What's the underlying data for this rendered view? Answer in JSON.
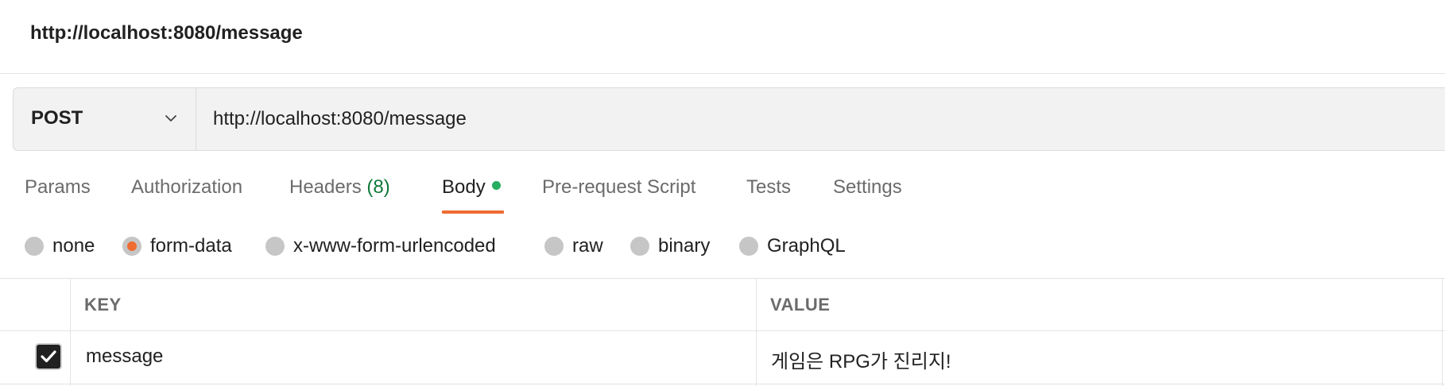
{
  "header": {
    "title": "http://localhost:8080/message"
  },
  "request": {
    "method": "POST",
    "url": "http://localhost:8080/message"
  },
  "tabs": [
    {
      "label": "Params"
    },
    {
      "label": "Authorization"
    },
    {
      "label": "Headers",
      "count": "(8)"
    },
    {
      "label": "Body",
      "active": true
    },
    {
      "label": "Pre-request Script"
    },
    {
      "label": "Tests"
    },
    {
      "label": "Settings"
    }
  ],
  "body_types": [
    {
      "label": "none"
    },
    {
      "label": "form-data",
      "selected": true
    },
    {
      "label": "x-www-form-urlencoded"
    },
    {
      "label": "raw"
    },
    {
      "label": "binary"
    },
    {
      "label": "GraphQL"
    }
  ],
  "table": {
    "headers": {
      "key": "KEY",
      "value": "VALUE"
    },
    "rows": [
      {
        "checked": true,
        "key": "message",
        "value": "게임은 RPG가 진리지!"
      }
    ]
  },
  "colors": {
    "accent": "#ef6c33",
    "dot": "#27ae60",
    "count": "#0e7a3a"
  }
}
